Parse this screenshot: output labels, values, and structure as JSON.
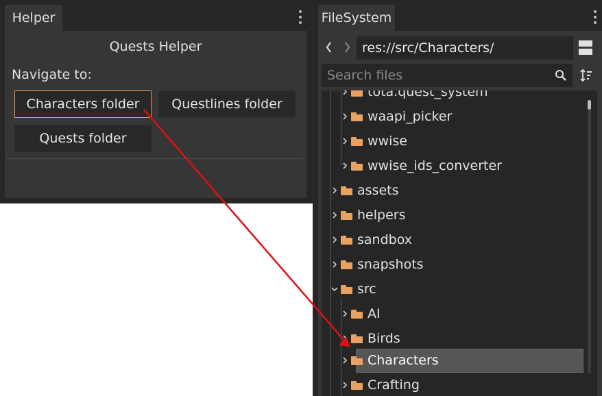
{
  "helper": {
    "tab_label": "Helper",
    "title": "Quests Helper",
    "navigate_label": "Navigate to:",
    "buttons": {
      "characters": "Characters folder",
      "questlines": "Questlines folder",
      "quests": "Quests folder"
    }
  },
  "filesystem": {
    "tab_label": "FileSystem",
    "path": "res://src/Characters/",
    "search_placeholder": "Search files",
    "tree": [
      {
        "label": "tota.quest_system",
        "expanded": false
      },
      {
        "label": "waapi_picker",
        "expanded": false
      },
      {
        "label": "wwise",
        "expanded": false
      },
      {
        "label": "wwise_ids_converter",
        "expanded": false
      },
      {
        "label": "assets",
        "expanded": false
      },
      {
        "label": "helpers",
        "expanded": false
      },
      {
        "label": "sandbox",
        "expanded": false
      },
      {
        "label": "snapshots",
        "expanded": false
      },
      {
        "label": "src",
        "expanded": true
      },
      {
        "label": "AI",
        "expanded": false
      },
      {
        "label": "Birds",
        "expanded": false
      },
      {
        "label": "Characters",
        "expanded": false,
        "selected": true
      },
      {
        "label": "Crafting",
        "expanded": false
      }
    ]
  },
  "colors": {
    "accent": "#e09a4a",
    "folder": "#e9a262",
    "arrow": "#e01010",
    "selection": "#565656"
  }
}
